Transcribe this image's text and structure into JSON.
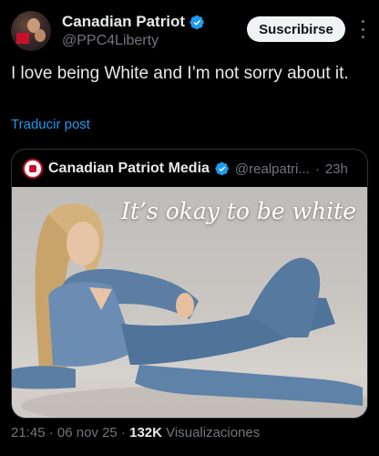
{
  "author": {
    "display_name": "Canadian Patriot",
    "handle": "@PPC4Liberty",
    "verified": true
  },
  "actions": {
    "subscribe_label": "Suscribirse",
    "more_icon": "more-vertical-icon"
  },
  "post": {
    "text": "I love being White and I’m not sorry about it.",
    "translate_label": "Traducir post"
  },
  "quoted_post": {
    "display_name": "Canadian Patriot Media",
    "handle": "@realpatri...",
    "separator": "·",
    "time_ago": "23h",
    "verified": true,
    "media_caption": "It’s okay to be white"
  },
  "meta": {
    "time": "21:45",
    "date": "06 nov 25",
    "views_count": "132K",
    "views_label": "Visualizaciones",
    "separator": "·"
  },
  "colors": {
    "background": "#000000",
    "text": "#e7e9ea",
    "muted": "#71767b",
    "link": "#1d9bf0",
    "verified_badge": "#1d9bf0"
  }
}
